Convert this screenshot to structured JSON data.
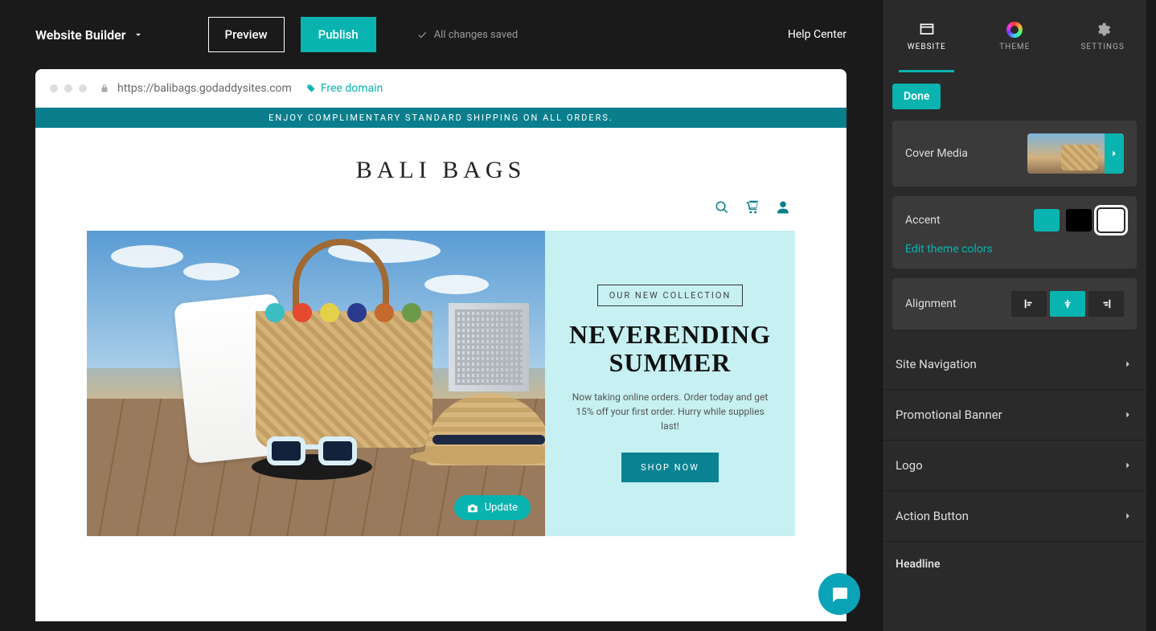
{
  "topbar": {
    "brand": "Website Builder",
    "preview": "Preview",
    "publish": "Publish",
    "saved": "All changes saved",
    "help": "Help Center"
  },
  "browser": {
    "url": "https://balibags.godaddysites.com",
    "free_domain": "Free domain"
  },
  "site": {
    "promo": "ENJOY COMPLIMENTARY STANDARD SHIPPING ON ALL ORDERS.",
    "title": "BALI BAGS",
    "tagline": "OUR NEW COLLECTION",
    "headline": "NEVERENDING SUMMER",
    "subtext": "Now taking online orders. Order today and get 15% off your first order. Hurry while supplies last!",
    "cta": "SHOP NOW",
    "update": "Update"
  },
  "panel": {
    "tabs": {
      "website": "WEBSITE",
      "theme": "THEME",
      "settings": "SETTINGS"
    },
    "done": "Done",
    "cover_media": "Cover Media",
    "accent": "Accent",
    "edit_colors": "Edit theme colors",
    "alignment": "Alignment",
    "sections": [
      "Site Navigation",
      "Promotional Banner",
      "Logo",
      "Action Button"
    ],
    "headline": "Headline",
    "colors": {
      "teal": "#09b3af",
      "black": "#000000",
      "white": "#ffffff"
    }
  }
}
